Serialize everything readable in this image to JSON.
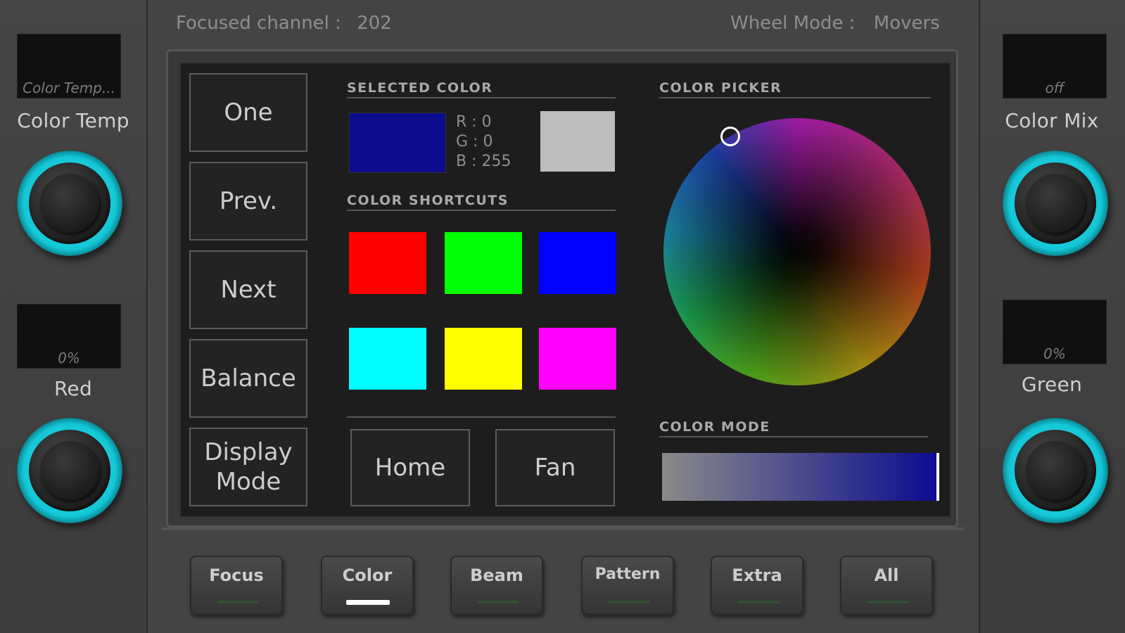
{
  "header": {
    "focused_channel_label": "Focused channel :",
    "focused_channel_value": "202",
    "wheel_mode_label": "Wheel Mode :",
    "wheel_mode_value": "Movers"
  },
  "left_controls": [
    {
      "display": "Color Temp...",
      "label": "Color Temp"
    },
    {
      "display": "0%",
      "label": "Red"
    }
  ],
  "right_controls": [
    {
      "display": "off",
      "label": "Color Mix"
    },
    {
      "display": "0%",
      "label": "Green"
    }
  ],
  "mode_buttons": [
    "One",
    "Prev.",
    "Next",
    "Balance",
    "Display Mode"
  ],
  "selected_color": {
    "title": "SELECTED COLOR",
    "swatch_color": "#0c0c8c",
    "r": "R : 0",
    "g": "G : 0",
    "b": "B : 255",
    "secondary_swatch_color": "#bdbdbd"
  },
  "color_shortcuts": {
    "title": "COLOR SHORTCUTS",
    "colors": [
      "#ff0000",
      "#00ff00",
      "#0000ff",
      "#00ffff",
      "#ffff00",
      "#ff00ff"
    ]
  },
  "action_buttons": [
    "Home",
    "Fan"
  ],
  "color_picker": {
    "title": "COLOR PICKER"
  },
  "color_mode": {
    "title": "COLOR MODE",
    "gradient_start": "#8a8a8a",
    "gradient_end": "#0b0b90"
  },
  "tabs": [
    {
      "label": "Focus",
      "active": false
    },
    {
      "label": "Color",
      "active": true
    },
    {
      "label": "Beam",
      "active": false
    },
    {
      "label": "Pattern",
      "active": false
    },
    {
      "label": "Extra",
      "active": false
    },
    {
      "label": "All",
      "active": false
    }
  ],
  "colors": {
    "knob_accent": "#14c6d6",
    "panel_bg": "#1d1d1d"
  }
}
